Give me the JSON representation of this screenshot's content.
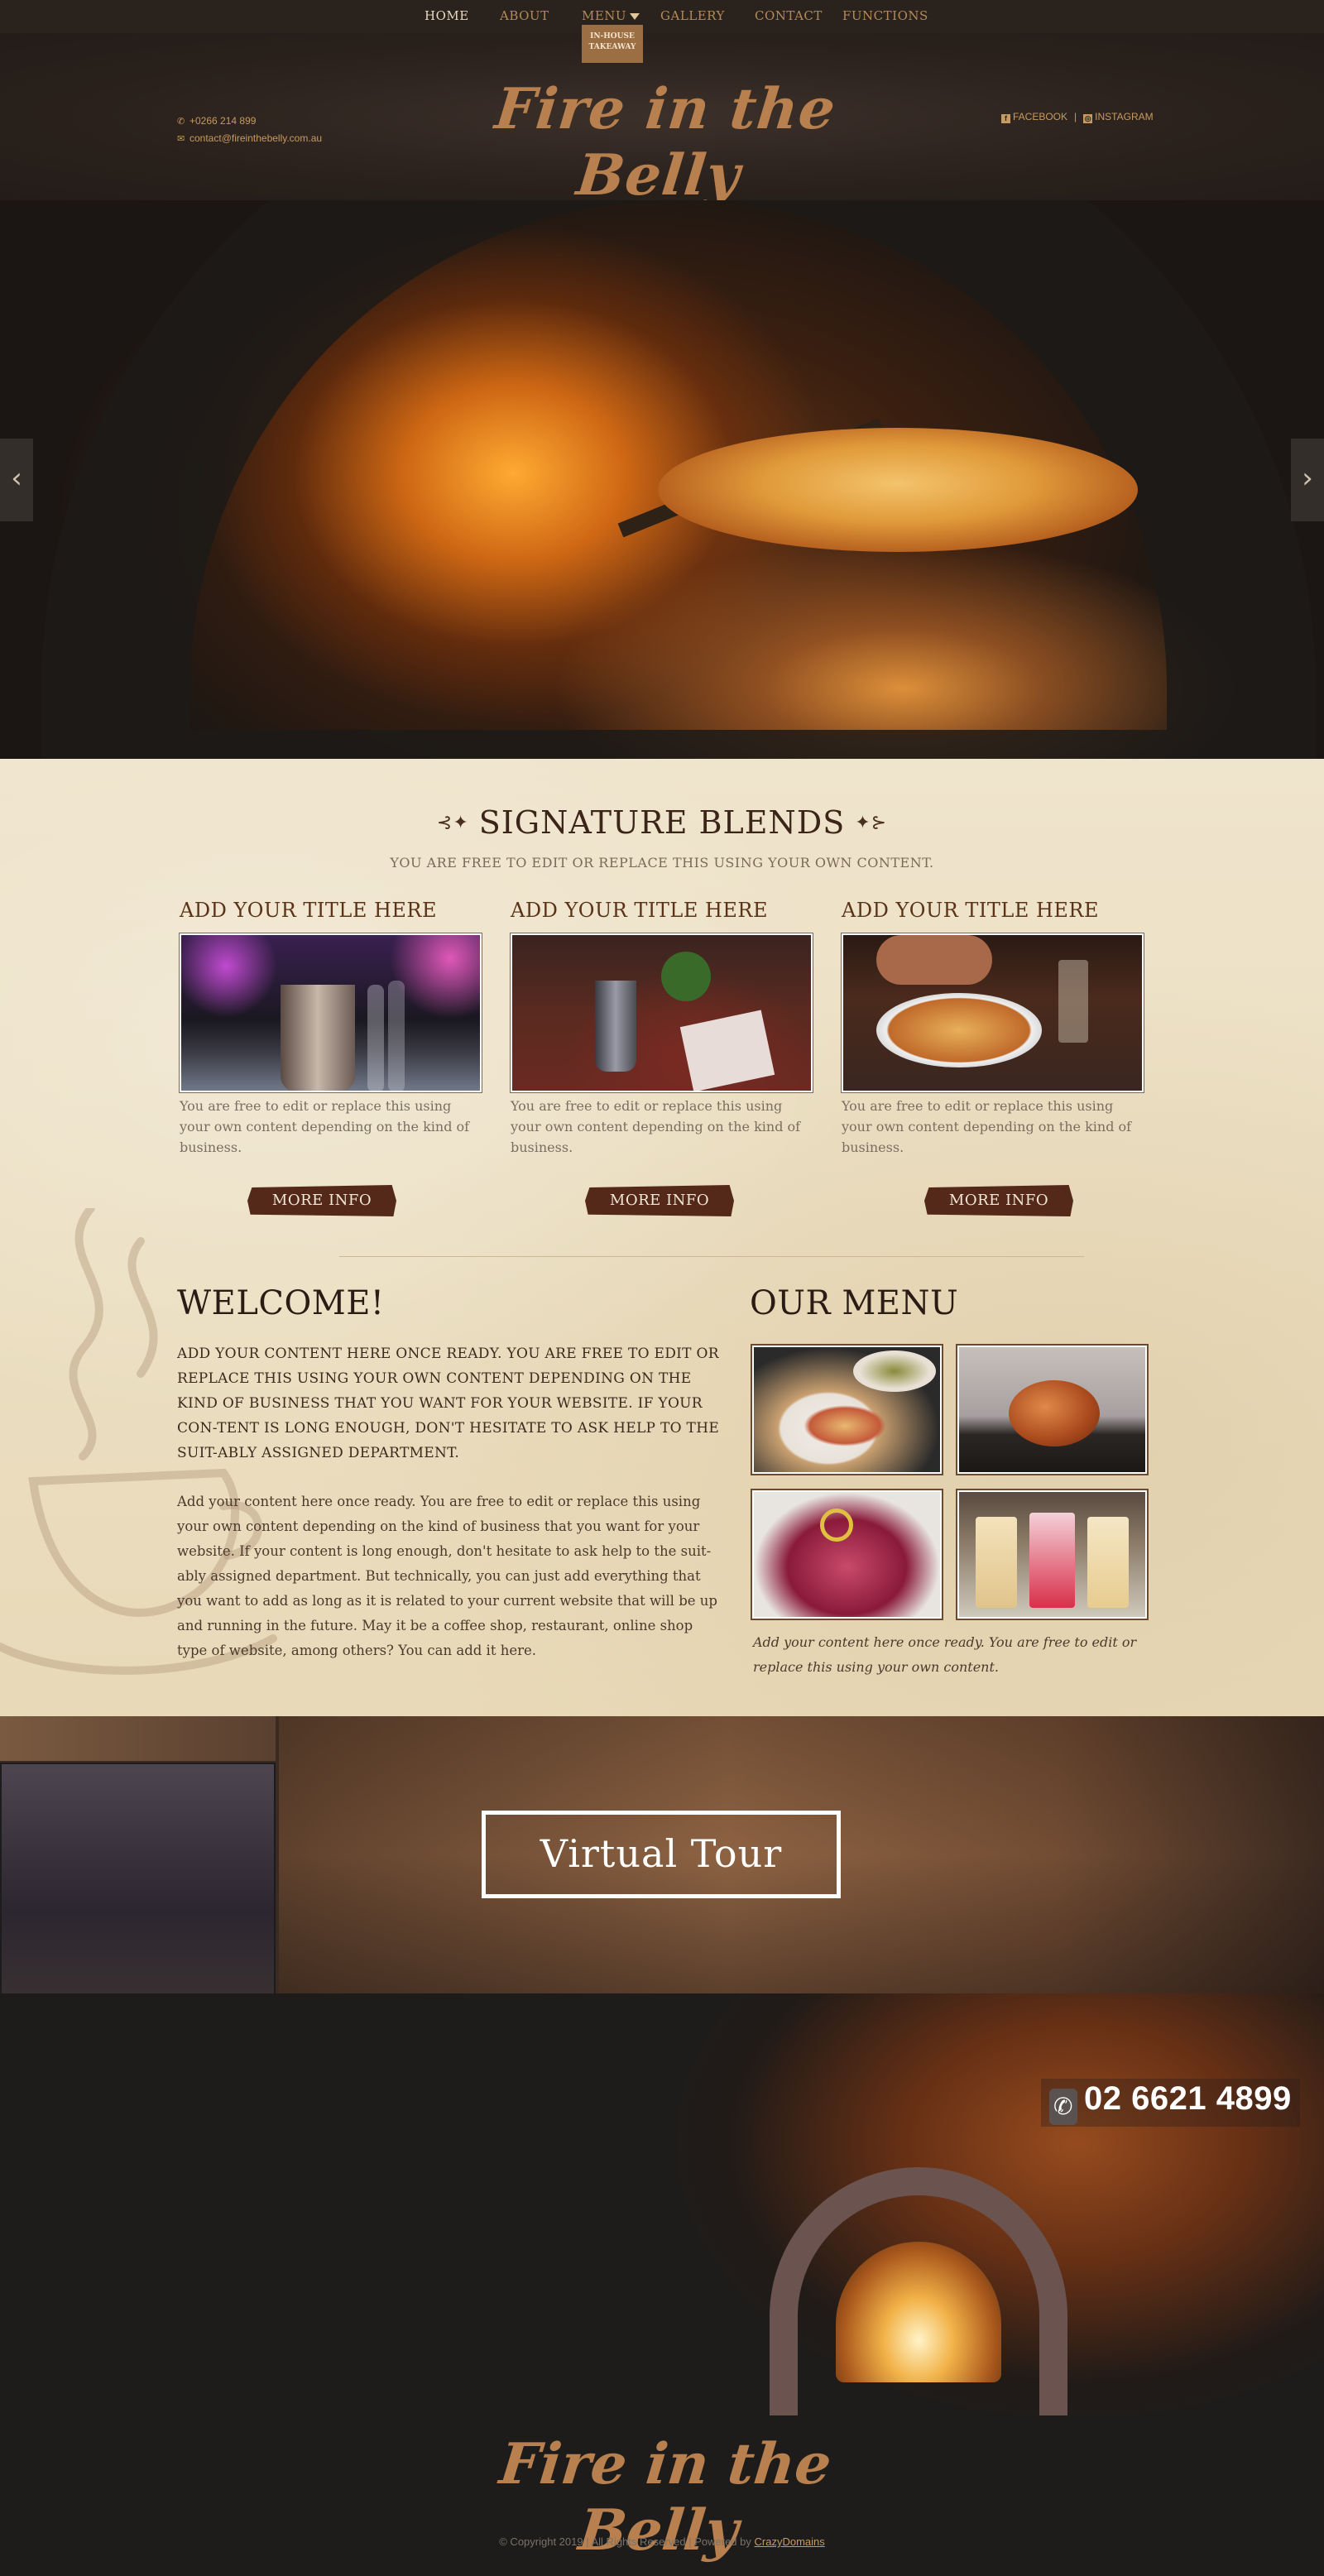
{
  "nav": {
    "items": [
      {
        "label": "HOME"
      },
      {
        "label": "ABOUT"
      },
      {
        "label": "MENU"
      },
      {
        "label": "GALLERY"
      },
      {
        "label": "CONTACT"
      },
      {
        "label": "FUNCTIONS"
      }
    ],
    "takeaway_label": "IN-HOUSE\nTAKEAWAY"
  },
  "header": {
    "phone": "+0266 214 899",
    "email": "contact@fireinthebelly.com.au",
    "logo": "Fire in the Belly",
    "facebook": "FACEBOOK",
    "instagram": "INSTAGRAM"
  },
  "hero": {
    "prev_label": "‹",
    "next_label": "›"
  },
  "signature": {
    "title": "SIGNATURE BLENDS",
    "subtitle": "YOU ARE FREE TO EDIT OR REPLACE THIS USING YOUR OWN CONTENT.",
    "cards": [
      {
        "title": "ADD YOUR TITLE HERE",
        "text": "You are free to edit or replace this using your own content depending on the kind of business.",
        "button": "MORE INFO"
      },
      {
        "title": "ADD YOUR TITLE HERE",
        "text": "You are free to edit or replace this using your own content depending on the kind of business.",
        "button": "MORE INFO"
      },
      {
        "title": "ADD YOUR TITLE HERE",
        "text": "You are free to edit or replace this using your own content depending on the kind of business.",
        "button": "MORE INFO"
      }
    ]
  },
  "welcome": {
    "title": "WELCOME!",
    "caps": "ADD YOUR CONTENT HERE ONCE READY. YOU ARE FREE TO EDIT OR REPLACE THIS USING YOUR OWN CONTENT DEPENDING ON THE KIND OF BUSINESS THAT YOU WANT FOR YOUR WEBSITE. IF YOUR CON-TENT IS LONG ENOUGH, DON'T HESITATE TO ASK HELP TO THE SUIT-ABLY ASSIGNED DEPARTMENT.",
    "body": "Add your content here once ready. You are free to edit or replace this using your own content depending on the kind of business that you want for your website. If your content is long enough, don't hesitate to ask help to the suit-ably assigned department.  But technically, you can just add everything that you want to add as long as it is related to your current website that will be up and running in the future. May it be a coffee shop, restaurant, online shop type of website, among others? You can add it here."
  },
  "our_menu": {
    "title": "OUR MENU",
    "caption": "Add your content here once ready. You are free to edit or replace this using your own content."
  },
  "tour": {
    "label": "Virtual Tour"
  },
  "footer": {
    "phone": "02 6621 4899",
    "logo": "Fire in the Belly",
    "copyright": "© Copyright 2019 |  All Rights Reserved   |   Powered by ",
    "powered_by": "CrazyDomains"
  },
  "colors": {
    "accent": "#b8804e",
    "button": "#54291a",
    "parchment": "#ece0c4",
    "dark": "#1d1c1b"
  }
}
